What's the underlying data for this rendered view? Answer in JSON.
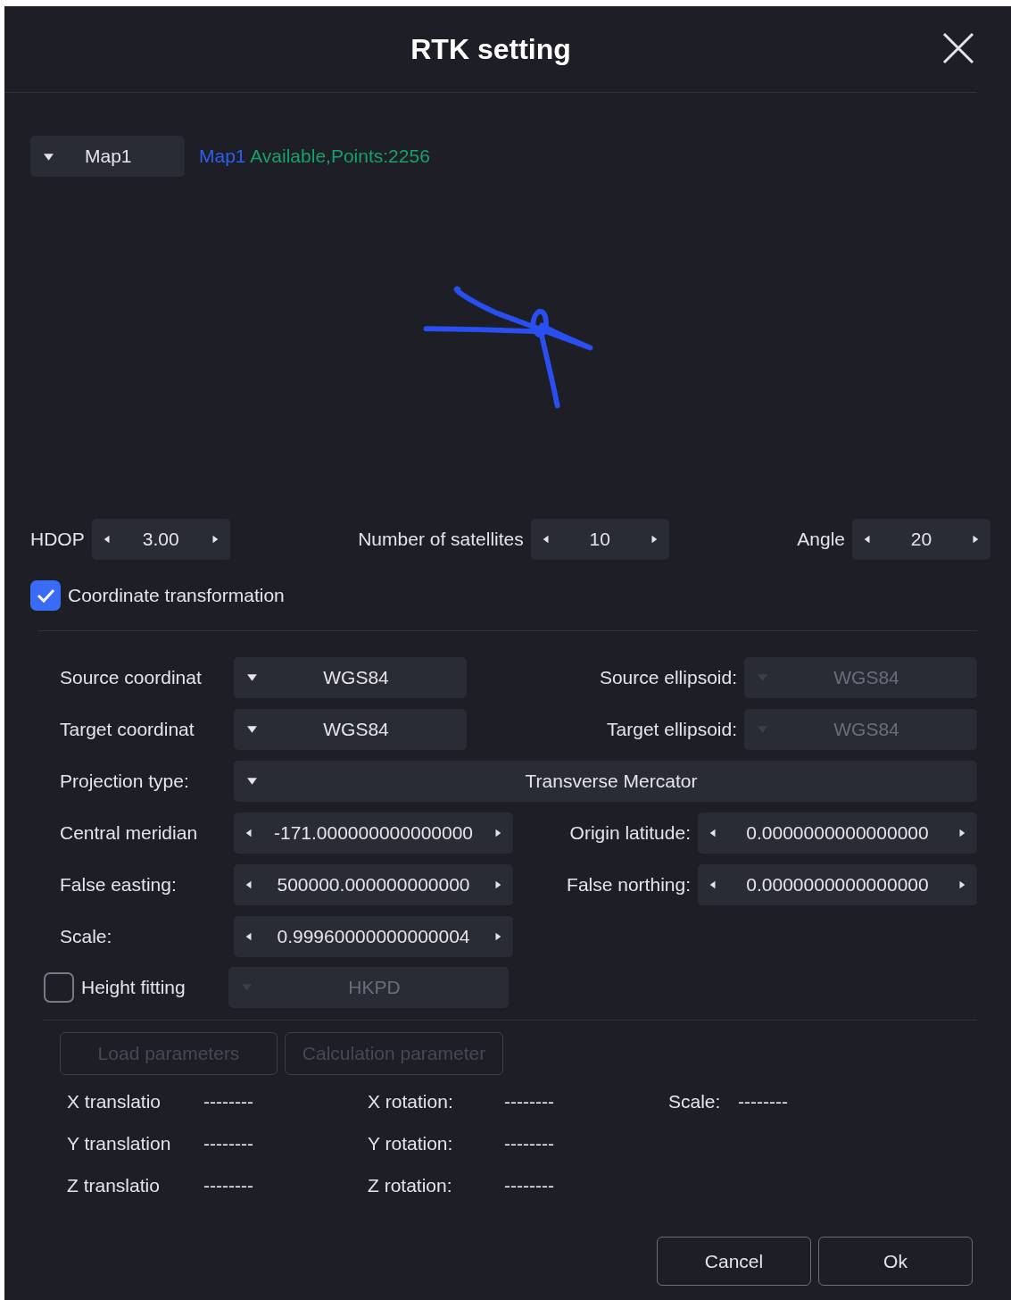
{
  "dialog": {
    "title": "RTK setting"
  },
  "map_select": {
    "value": "Map1"
  },
  "map_status": {
    "name": "Map1",
    "text": "Available,Points:2256"
  },
  "filters": [
    {
      "label": "HDOP",
      "value": "3.00"
    },
    {
      "label": "Number of satellites",
      "value": "10"
    },
    {
      "label": "Angle",
      "value": "20"
    }
  ],
  "coordinate_transformation": {
    "label": "Coordinate transformation",
    "checked": true
  },
  "param_rows": [
    {
      "fields": [
        {
          "label": "Source coordinat",
          "kind": "select",
          "value": "WGS84",
          "disabled": false
        },
        {
          "label": "Source ellipsoid:",
          "kind": "select",
          "value": "WGS84",
          "disabled": true
        }
      ]
    },
    {
      "fields": [
        {
          "label": "Target coordinat",
          "kind": "select",
          "value": "WGS84",
          "disabled": false
        },
        {
          "label": "Target ellipsoid:",
          "kind": "select",
          "value": "WGS84",
          "disabled": true
        }
      ]
    },
    {
      "fields": [
        {
          "label": "Projection type:",
          "kind": "select",
          "value": "Transverse Mercator",
          "disabled": false,
          "wide": true
        }
      ]
    },
    {
      "fields": [
        {
          "label": "Central meridian",
          "kind": "spin",
          "value": "-171.000000000000000",
          "disabled": false
        },
        {
          "label": "Origin latitude:",
          "kind": "spin",
          "value": "0.0000000000000000",
          "disabled": false
        }
      ]
    },
    {
      "fields": [
        {
          "label": "False easting:",
          "kind": "spin",
          "value": "500000.000000000000",
          "disabled": false
        },
        {
          "label": "False northing:",
          "kind": "spin",
          "value": "0.0000000000000000",
          "disabled": false
        }
      ]
    },
    {
      "fields": [
        {
          "label": "Scale:",
          "kind": "spin",
          "value": "0.99960000000000004",
          "disabled": false
        }
      ]
    }
  ],
  "height_fitting": {
    "label": "Height fitting",
    "checked": false,
    "select": {
      "value": "HKPD",
      "disabled": true
    }
  },
  "actions": [
    {
      "label": "Load parameters",
      "disabled": true
    },
    {
      "label": "Calculation parameter",
      "disabled": true
    }
  ],
  "results": [
    [
      {
        "label": "X translatio",
        "value": "--------"
      },
      {
        "label": "X rotation:",
        "value": "--------"
      },
      {
        "label": "Scale:",
        "value": "--------"
      }
    ],
    [
      {
        "label": "Y translation",
        "value": "--------"
      },
      {
        "label": "Y rotation:",
        "value": "--------"
      }
    ],
    [
      {
        "label": "Z translatio",
        "value": "--------"
      },
      {
        "label": "Z rotation:",
        "value": "--------"
      }
    ]
  ],
  "buttons": [
    {
      "label": "Cancel"
    },
    {
      "label": "Ok"
    }
  ]
}
